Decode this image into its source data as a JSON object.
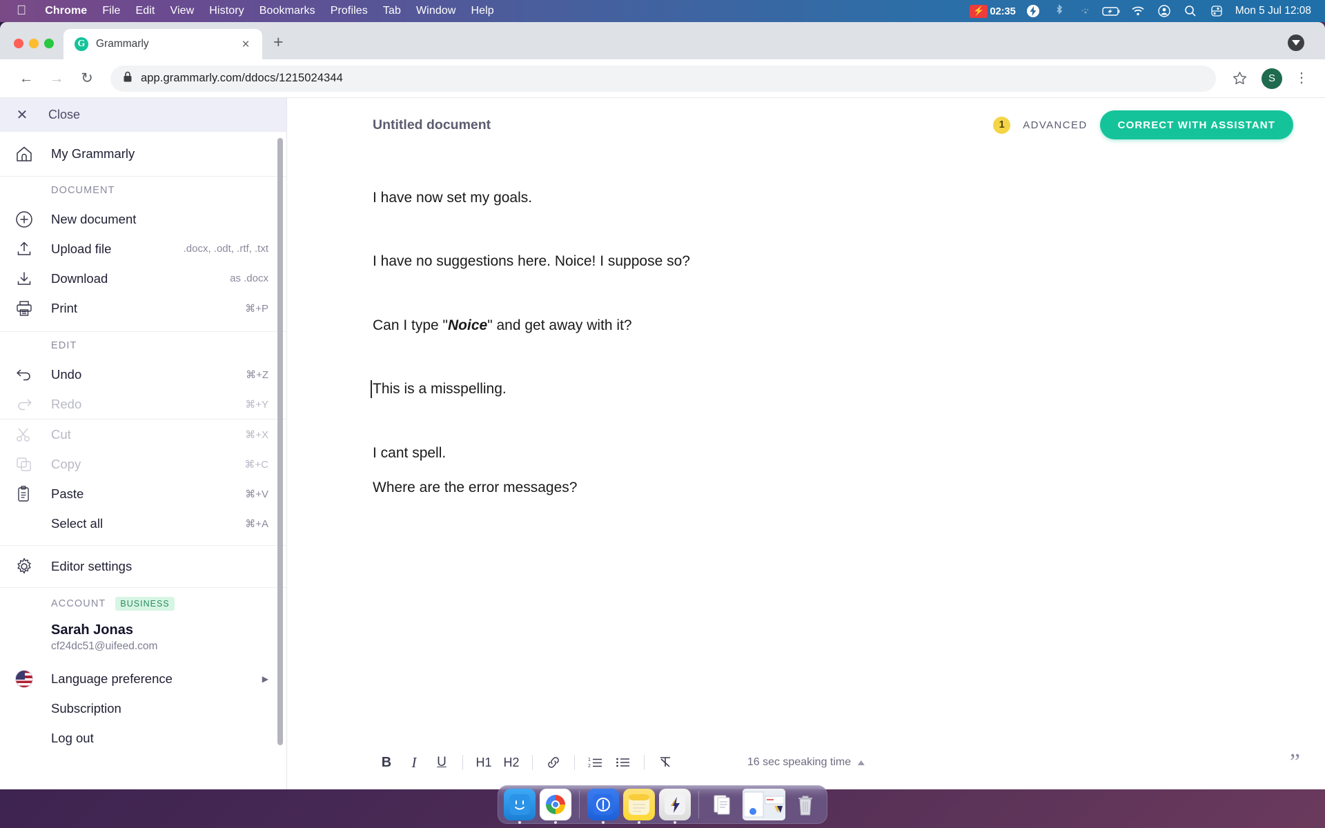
{
  "menubar": {
    "apple": "apple-logo",
    "items": [
      "Chrome",
      "File",
      "Edit",
      "View",
      "History",
      "Bookmarks",
      "Profiles",
      "Tab",
      "Window",
      "Help"
    ],
    "recording_time": "02:35",
    "clock": "Mon 5 Jul  12:08",
    "status_icons": [
      "screen-recording-icon",
      "bolt-icon",
      "bluetooth-icon",
      "airdrop-icon",
      "battery-charging-icon",
      "wifi-icon",
      "user-account-icon",
      "spotlight-search-icon",
      "control-center-icon"
    ]
  },
  "browser": {
    "tab": {
      "title": "Grammarly",
      "favicon_letter": "G"
    },
    "new_tab_label": "+",
    "close_tab_label": "×",
    "back_label": "←",
    "forward_label": "→",
    "reload_label": "↻",
    "url": "app.grammarly.com/ddocs/1215024344",
    "lock_icon": "lock-icon",
    "bookmark_icon": "star-icon",
    "profile_initial": "S",
    "menu_icon": "three-dot-menu-icon",
    "download_icon": "download-indicator-icon"
  },
  "sidebar": {
    "close_label": "Close",
    "home": {
      "label": "My Grammarly",
      "icon": "home-icon"
    },
    "sections": [
      {
        "title": "DOCUMENT",
        "items": [
          {
            "label": "New document",
            "hint": "",
            "icon": "plus-circle-icon",
            "disabled": false
          },
          {
            "label": "Upload file",
            "hint": ".docx, .odt, .rtf, .txt",
            "icon": "upload-icon",
            "disabled": false
          },
          {
            "label": "Download",
            "hint": "as .docx",
            "icon": "download-icon",
            "disabled": false
          },
          {
            "label": "Print",
            "hint": "⌘+P",
            "icon": "printer-icon",
            "disabled": false
          }
        ]
      },
      {
        "title": "EDIT",
        "items": [
          {
            "label": "Undo",
            "hint": "⌘+Z",
            "icon": "undo-icon",
            "disabled": false
          },
          {
            "label": "Redo",
            "hint": "⌘+Y",
            "icon": "redo-icon",
            "disabled": true
          },
          {
            "label": "Cut",
            "hint": "⌘+X",
            "icon": "scissors-icon",
            "disabled": true
          },
          {
            "label": "Copy",
            "hint": "⌘+C",
            "icon": "copy-icon",
            "disabled": true
          },
          {
            "label": "Paste",
            "hint": "⌘+V",
            "icon": "clipboard-icon",
            "disabled": false
          },
          {
            "label": "Select all",
            "hint": "⌘+A",
            "icon": "",
            "disabled": false
          }
        ]
      }
    ],
    "editor_settings": {
      "label": "Editor settings",
      "icon": "gear-icon"
    },
    "account": {
      "title": "ACCOUNT",
      "badge": "BUSINESS",
      "name": "Sarah Jonas",
      "email": "cf24dc51@uifeed.com",
      "language_preference": {
        "label": "Language preference",
        "icon": "us-flag-icon",
        "caret": "▶"
      },
      "subscription": "Subscription",
      "logout": "Log out"
    }
  },
  "editor": {
    "doc_title": "Untitled document",
    "score": "1",
    "goal_label": "ADVANCED",
    "assistant_button": "CORRECT WITH ASSISTANT",
    "paragraphs": [
      {
        "text": "I have now set my goals.",
        "caret": false
      },
      {
        "text": "I have no suggestions here. Noice! I suppose so?",
        "caret": false
      },
      {
        "pre": "Can I type \"",
        "emphasis": "Noice",
        "post": "\" and get away with it?",
        "caret": false
      },
      {
        "text": "This is a misspelling.",
        "caret": true
      },
      {
        "text": "I cant spell.",
        "caret": false
      },
      {
        "text": "Where are the error messages?",
        "caret": false
      }
    ],
    "toolbar": {
      "bold": "B",
      "italic": "I",
      "underline": "U",
      "h1": "H1",
      "h2": "H2",
      "link_icon": "link-icon",
      "ordered_list_icon": "numbered-list-icon",
      "bullet_list_icon": "bullet-list-icon",
      "clear_format_icon": "clear-formatting-icon",
      "speaking_time": "16 sec speaking time",
      "speaking_caret": "▲",
      "quote_icon": "quote-icon"
    }
  },
  "dock": {
    "apps": [
      "finder-icon",
      "chrome-icon",
      "1password-icon",
      "notes-icon",
      "bolt-app-icon",
      "documents-icon",
      "screenshot-thumbnail-icon",
      "trash-icon"
    ]
  },
  "colors": {
    "accent_green": "#15c39a",
    "score_yellow": "#f5d547",
    "badge_green": "#d7f5e4",
    "sidebar_header": "#eeeef8"
  }
}
